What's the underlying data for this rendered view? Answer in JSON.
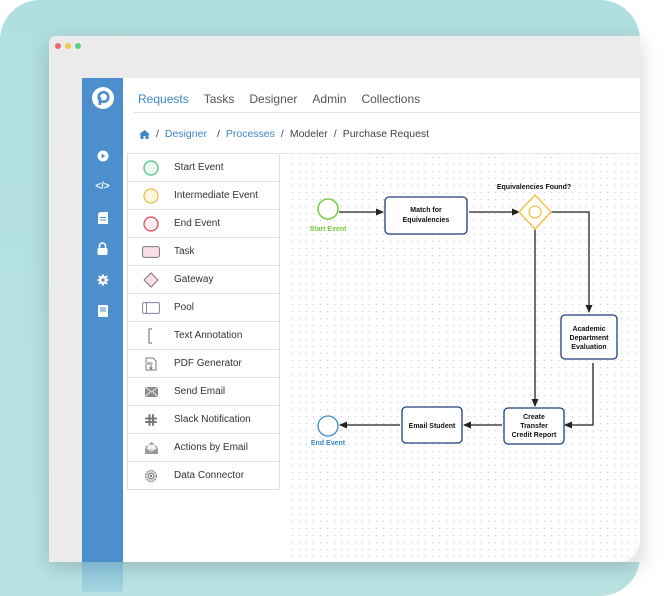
{
  "window": {
    "traffic_lights": [
      {
        "name": "close",
        "color": "#ec6a6a"
      },
      {
        "name": "minimize",
        "color": "#f1c94e"
      },
      {
        "name": "maximize",
        "color": "#5ccf86"
      }
    ]
  },
  "colors": {
    "sidebar": "#4c8fcc",
    "link": "#3a87c7",
    "start_event": "#7ac943",
    "end_event": "#3a87c7",
    "gateway": "#f5c244",
    "task_border": "#1d3f7a"
  },
  "sidebar": {
    "logo": "processmaker-logo",
    "items": [
      {
        "icon": "play-circle-icon"
      },
      {
        "icon": "code-icon"
      },
      {
        "icon": "document-icon"
      },
      {
        "icon": "lock-icon"
      },
      {
        "icon": "gear-icon"
      },
      {
        "icon": "book-icon"
      }
    ]
  },
  "topnav": {
    "items": [
      {
        "label": "Requests",
        "active": true
      },
      {
        "label": "Tasks"
      },
      {
        "label": "Designer"
      },
      {
        "label": "Admin"
      },
      {
        "label": "Collections"
      }
    ]
  },
  "breadcrumb": {
    "home_icon": "home-icon",
    "items": [
      "Designer",
      "Processes",
      "Modeler",
      "Purchase Request"
    ],
    "separator": "/"
  },
  "palette": {
    "items": [
      {
        "label": "Start Event",
        "icon": "start-event-icon"
      },
      {
        "label": "Intermediate Event",
        "icon": "intermediate-event-icon"
      },
      {
        "label": "End Event",
        "icon": "end-event-icon"
      },
      {
        "label": "Task",
        "icon": "task-icon"
      },
      {
        "label": "Gateway",
        "icon": "gateway-icon"
      },
      {
        "label": "Pool",
        "icon": "pool-icon"
      },
      {
        "label": "Text Annotation",
        "icon": "text-annotation-icon"
      },
      {
        "label": "PDF Generator",
        "icon": "pdf-generator-icon"
      },
      {
        "label": "Send Email",
        "icon": "envelope-icon"
      },
      {
        "label": "Slack Notification",
        "icon": "slack-icon"
      },
      {
        "label": "Actions by Email",
        "icon": "open-envelope-icon"
      },
      {
        "label": "Data Connector",
        "icon": "data-connector-icon"
      }
    ]
  },
  "diagram": {
    "start_label": "Start Event",
    "end_label": "End Event",
    "gateway_label": "Equivalencies Found?",
    "tasks": {
      "match": [
        "Match for",
        "Equivalencies"
      ],
      "academic": [
        "Academic",
        "Department",
        "Evaluation"
      ],
      "create": [
        "Create",
        "Transfer",
        "Credit Report"
      ],
      "email": [
        "Email Student"
      ]
    }
  }
}
